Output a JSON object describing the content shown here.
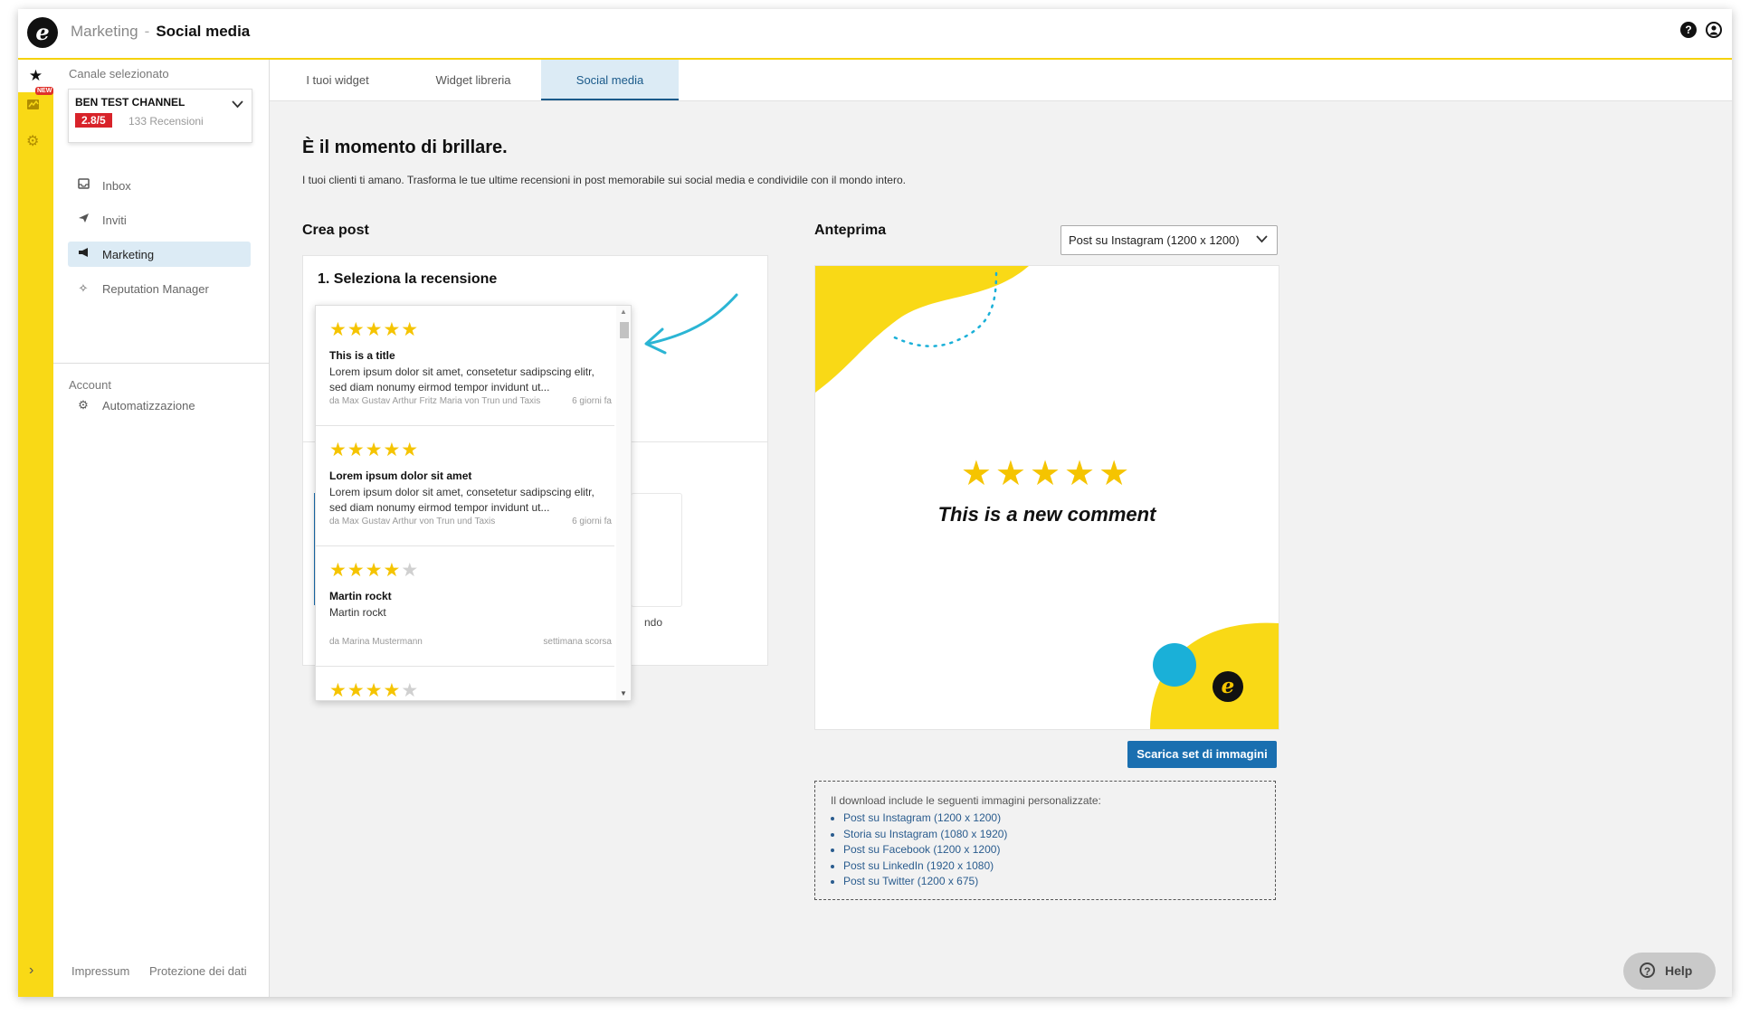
{
  "header": {
    "logo_letter": "e",
    "breadcrumb_parent": "Marketing",
    "breadcrumb_separator": "-",
    "breadcrumb_current": "Social media",
    "help_icon_glyph": "?",
    "user_icon": "user-circle-icon"
  },
  "rail": {
    "new_badge": "NEW",
    "icons": [
      "star-icon",
      "new-feature-icon",
      "gear-icon",
      "chevron-right-icon"
    ]
  },
  "sidebar": {
    "channel_label": "Canale selezionato",
    "channel_name": "BEN TEST CHANNEL",
    "channel_rating": "2.8/5",
    "channel_reviews": "133 Recensioni",
    "nav": [
      {
        "label": "Inbox",
        "icon": "inbox-icon",
        "active": false
      },
      {
        "label": "Inviti",
        "icon": "send-icon",
        "active": false
      },
      {
        "label": "Marketing",
        "icon": "megaphone-icon",
        "active": true
      },
      {
        "label": "Reputation Manager",
        "icon": "sparkle-icon",
        "active": false
      }
    ],
    "account_label": "Account",
    "account_nav": [
      {
        "label": "Automatizzazione",
        "icon": "automation-gear-icon"
      }
    ],
    "footer_links": [
      "Impressum",
      "Protezione dei dati"
    ]
  },
  "tabs": [
    {
      "label": "I tuoi widget",
      "active": false
    },
    {
      "label": "Widget libreria",
      "active": false
    },
    {
      "label": "Social media",
      "active": true
    }
  ],
  "main": {
    "heading": "È il momento di brillare.",
    "intro": "I tuoi clienti ti amano. Trasforma le tue ultime recensioni in post memorabile sui social media e condividile con il mondo intero.",
    "create_title": "Crea post",
    "step_title": "1. Seleziona la recensione",
    "hidden_option_fragment": "ndo"
  },
  "reviews": [
    {
      "rating": 5,
      "title": "This is a title",
      "body": "Lorem ipsum dolor sit amet, consetetur sadipscing elitr, sed diam nonumy eirmod tempor invidunt ut...",
      "author": "da Max Gustav Arthur Fritz Maria von Trun und Taxis",
      "date": "6 giorni fa"
    },
    {
      "rating": 5,
      "title": "Lorem ipsum dolor sit amet",
      "body": "Lorem ipsum dolor sit amet, consetetur sadipscing elitr, sed diam nonumy eirmod tempor invidunt ut...",
      "author": "da Max Gustav Arthur von Trun und Taxis",
      "date": "6 giorni fa"
    },
    {
      "rating": 4,
      "title": "Martin rockt",
      "body": "Martin rockt",
      "author": "da Marina Mustermann",
      "date": "settimana scorsa"
    },
    {
      "rating": 4,
      "title": "",
      "body": "",
      "author": "",
      "date": ""
    }
  ],
  "preview": {
    "title": "Anteprima",
    "format_selected": "Post su Instagram (1200 x 1200)",
    "rating": 5,
    "comment": "This is a new comment",
    "logo_letter": "e",
    "download_button": "Scarica set di immagini",
    "download_info_title": "Il download include le seguenti immagini personalizzate:",
    "download_formats": [
      "Post su Instagram (1200 x 1200)",
      "Storia su Instagram (1080 x 1920)",
      "Post su Facebook (1200 x 1200)",
      "Post su LinkedIn (1920 x 1080)",
      "Post su Twitter (1200 x 675)"
    ]
  },
  "help": {
    "label": "Help",
    "icon": "question-circle-icon",
    "glyph": "?"
  },
  "colors": {
    "brand_yellow": "#f9d916",
    "primary_blue": "#1a6fb0",
    "rating_red": "#d8232a",
    "star_yellow": "#f5c400",
    "accent_cyan": "#1ab0d8",
    "active_bg": "#dcebf5"
  }
}
